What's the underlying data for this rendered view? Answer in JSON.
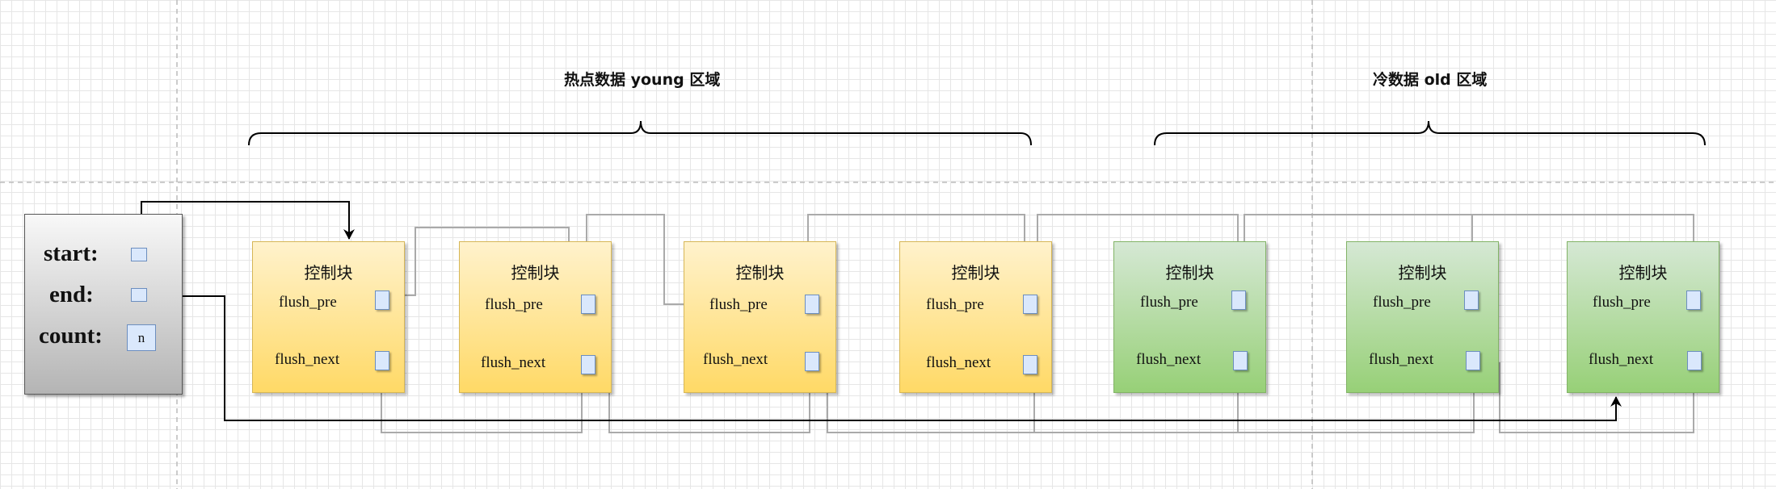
{
  "regions": {
    "young_label": "热点数据 young 区域",
    "old_label": "冷数据 old 区域"
  },
  "list": {
    "start_label": "start:",
    "end_label": "end:",
    "count_label": "count:",
    "count_value": "n"
  },
  "blocks": [
    {
      "title": "控制块",
      "pre_label": "flush_pre",
      "next_label": "flush_next",
      "region": "young"
    },
    {
      "title": "控制块",
      "pre_label": "flush_pre",
      "next_label": "flush_next",
      "region": "young"
    },
    {
      "title": "控制块",
      "pre_label": "flush_pre",
      "next_label": "flush_next",
      "region": "young"
    },
    {
      "title": "控制块",
      "pre_label": "flush_pre",
      "next_label": "flush_next",
      "region": "young"
    },
    {
      "title": "控制块",
      "pre_label": "flush_pre",
      "next_label": "flush_next",
      "region": "old"
    },
    {
      "title": "控制块",
      "pre_label": "flush_pre",
      "next_label": "flush_next",
      "region": "old"
    },
    {
      "title": "控制块",
      "pre_label": "flush_pre",
      "next_label": "flush_next",
      "region": "old"
    }
  ],
  "colors": {
    "young_fill_top": "#fff2cc",
    "young_fill_bottom": "#ffd966",
    "old_fill_top": "#d5e8d4",
    "old_fill_bottom": "#97d077",
    "pointer_fill": "#dae8fc",
    "connector": "#aaaaaa",
    "list_connector": "#000000"
  }
}
